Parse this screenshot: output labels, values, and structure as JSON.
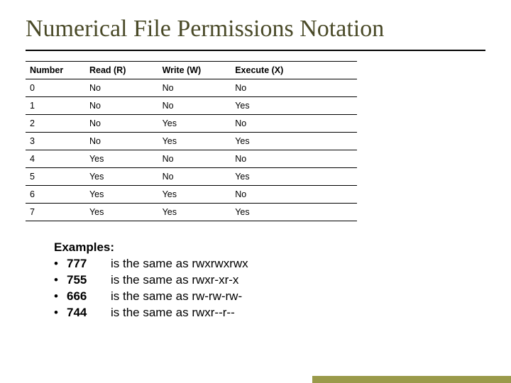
{
  "title": "Numerical File Permissions Notation",
  "table": {
    "headers": [
      "Number",
      "Read (R)",
      "Write (W)",
      "Execute (X)"
    ],
    "rows": [
      [
        "0",
        "No",
        "No",
        "No"
      ],
      [
        "1",
        "No",
        "No",
        "Yes"
      ],
      [
        "2",
        "No",
        "Yes",
        "No"
      ],
      [
        "3",
        "No",
        "Yes",
        "Yes"
      ],
      [
        "4",
        "Yes",
        "No",
        "No"
      ],
      [
        "5",
        "Yes",
        "No",
        "Yes"
      ],
      [
        "6",
        "Yes",
        "Yes",
        "No"
      ],
      [
        "7",
        "Yes",
        "Yes",
        "Yes"
      ]
    ]
  },
  "examples": {
    "heading": "Examples:",
    "items": [
      {
        "bullet": "•",
        "code": "777",
        "text": "is the same as rwxrwxrwx"
      },
      {
        "bullet": "•",
        "code": "755",
        "text": "is the same as rwxr-xr-x"
      },
      {
        "bullet": "•",
        "code": "666",
        "text": "is the same as rw-rw-rw-"
      },
      {
        "bullet": "•",
        "code": "744",
        "text": "is the same as rwxr--r--"
      }
    ]
  },
  "colors": {
    "title": "#4a4a28",
    "accent": "#9a9a4a"
  }
}
